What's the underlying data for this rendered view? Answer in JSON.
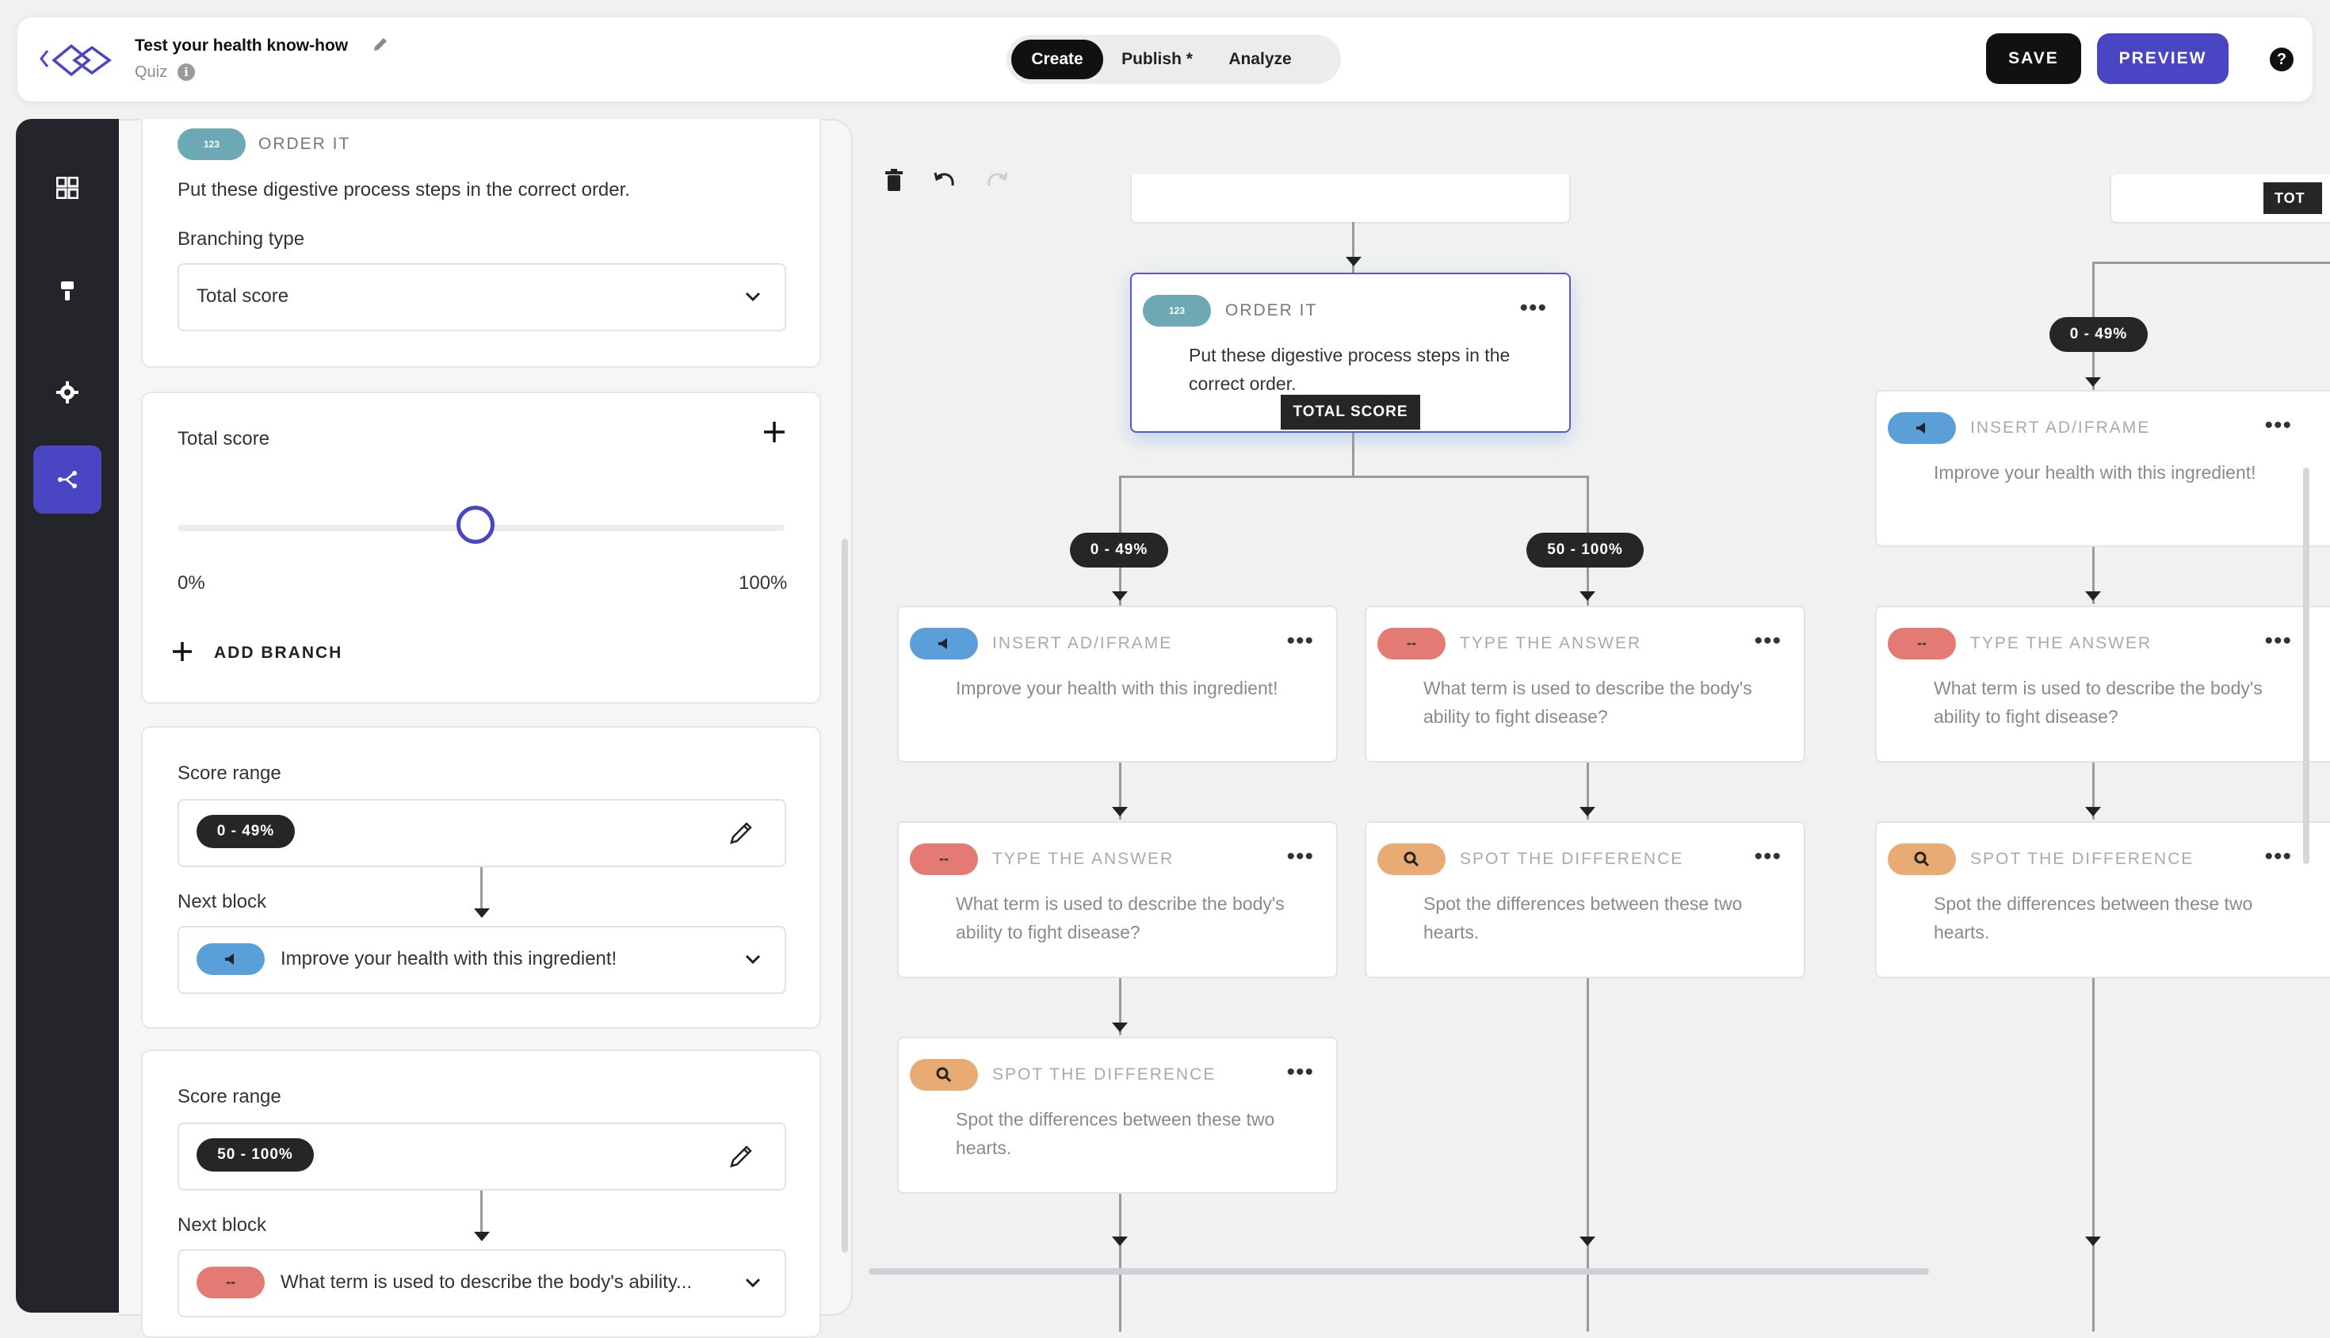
{
  "header": {
    "title": "Test your health know-how",
    "subtitle": "Quiz",
    "info_icon": "i",
    "tabs": [
      {
        "label": "Create",
        "active": true
      },
      {
        "label": "Publish *",
        "active": false
      },
      {
        "label": "Analyze",
        "active": false
      }
    ],
    "save_label": "SAVE",
    "preview_label": "PREVIEW",
    "help_icon": "?",
    "colors": {
      "accent": "#4a45c2",
      "dark": "#111111"
    }
  },
  "nav": {
    "items": [
      {
        "icon": "grid-icon"
      },
      {
        "icon": "paint-roller-icon"
      },
      {
        "icon": "gear-icon"
      },
      {
        "icon": "branch-icon",
        "active": true
      }
    ]
  },
  "panel": {
    "block": {
      "type_icon": "123",
      "type_label": "ORDER IT",
      "text": "Put these digestive process steps in the correct order.",
      "branching_label": "Branching type",
      "branching_value": "Total score"
    },
    "total_score": {
      "label": "Total score",
      "slider_value_percent": 49,
      "min_label": "0%",
      "max_label": "100%",
      "add_branch_label": "ADD BRANCH"
    },
    "branches": [
      {
        "score_range_label": "Score range",
        "range": "0 - 49%",
        "next_block_label": "Next block",
        "next_block_text": "Improve your health with this ingredient!",
        "next_block_icon": "megaphone-icon"
      },
      {
        "score_range_label": "Score range",
        "range": "50 - 100%",
        "next_block_label": "Next block",
        "next_block_text": "What term is used to describe the body's ability...",
        "next_block_icon": "--"
      }
    ]
  },
  "canvas": {
    "root": {
      "type_icon": "123",
      "type_label": "ORDER IT",
      "text": "Put these digestive process steps in the correct order.",
      "tag": "TOTAL SCORE"
    },
    "top_right_tag": "TOT",
    "branch_badges": [
      "0 - 49%",
      "50 - 100%",
      "0 - 49%"
    ],
    "nodes": {
      "ad": {
        "type_label": "INSERT AD/IFRAME",
        "text": "Improve your health with this ingredient!",
        "pill_text": ""
      },
      "type_answer": {
        "type_label": "TYPE THE ANSWER",
        "text": "What term is used to describe the body's ability to fight disease?",
        "pill_text": "--"
      },
      "spot": {
        "type_label": "SPOT THE DIFFERENCE",
        "text": "Spot the differences between these two hearts.",
        "pill_text": ""
      }
    },
    "menu_dots": "•••",
    "colors": {
      "order_it": "#6da9b4",
      "insert_ad": "#5b9fd8",
      "type_answer": "#e37a74",
      "spot_difference": "#e9ab74"
    }
  }
}
